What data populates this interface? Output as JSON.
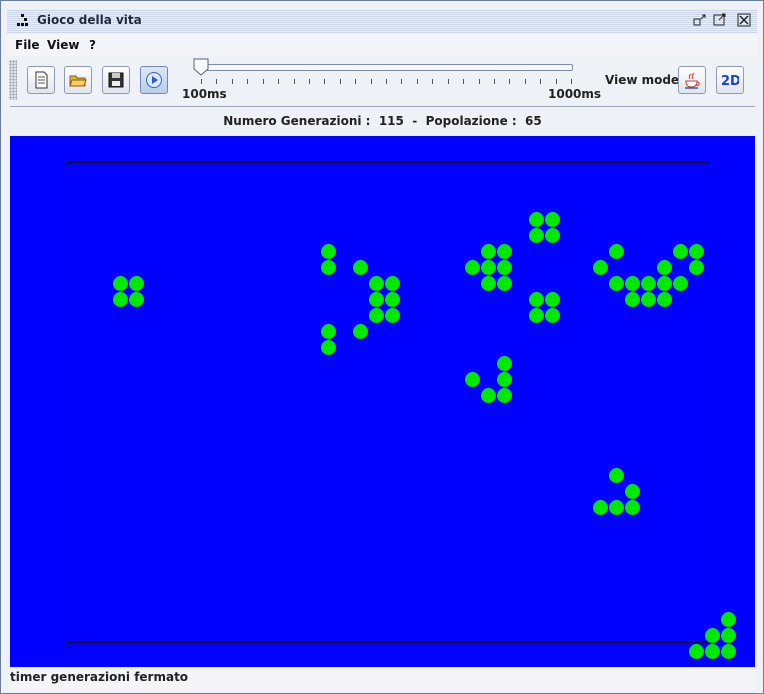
{
  "window": {
    "title": "Gioco della vita",
    "controls": [
      "restore-icon",
      "maximize-icon",
      "close-icon"
    ]
  },
  "menu": {
    "items": [
      "File",
      "View",
      "?"
    ]
  },
  "toolbar": {
    "buttons": [
      "new-file-icon",
      "open-folder-icon",
      "save-icon",
      "play-icon"
    ],
    "slider": {
      "min_label": "100ms",
      "max_label": "1000ms",
      "value_ms": 100
    },
    "view_mode_label": "View mode",
    "view_mode_buttons": [
      "java-3d-icon",
      "2d-icon"
    ]
  },
  "stats": {
    "generations_label": "Numero Generazioni :",
    "generations_value": "115",
    "separator": "-",
    "population_label": "Popolazione :",
    "population_value": "65"
  },
  "board": {
    "background": "#0000ff",
    "cell_color": "#00e800",
    "live_cells": [
      [
        1,
        6
      ],
      [
        2,
        6
      ],
      [
        1,
        7
      ],
      [
        2,
        7
      ],
      [
        14,
        4
      ],
      [
        14,
        5
      ],
      [
        16,
        5
      ],
      [
        17,
        6
      ],
      [
        18,
        6
      ],
      [
        17,
        7
      ],
      [
        18,
        7
      ],
      [
        17,
        8
      ],
      [
        18,
        8
      ],
      [
        14,
        9
      ],
      [
        16,
        9
      ],
      [
        14,
        10
      ],
      [
        27,
        2
      ],
      [
        28,
        2
      ],
      [
        27,
        3
      ],
      [
        28,
        3
      ],
      [
        24,
        4
      ],
      [
        25,
        4
      ],
      [
        23,
        5
      ],
      [
        24,
        5
      ],
      [
        25,
        5
      ],
      [
        24,
        6
      ],
      [
        25,
        6
      ],
      [
        27,
        7
      ],
      [
        28,
        7
      ],
      [
        27,
        8
      ],
      [
        28,
        8
      ],
      [
        25,
        11
      ],
      [
        23,
        12
      ],
      [
        25,
        12
      ],
      [
        24,
        13
      ],
      [
        25,
        13
      ],
      [
        32,
        4
      ],
      [
        36,
        4
      ],
      [
        37,
        4
      ],
      [
        31,
        5
      ],
      [
        35,
        5
      ],
      [
        37,
        5
      ],
      [
        32,
        6
      ],
      [
        33,
        6
      ],
      [
        34,
        6
      ],
      [
        35,
        6
      ],
      [
        36,
        6
      ],
      [
        33,
        7
      ],
      [
        34,
        7
      ],
      [
        35,
        7
      ],
      [
        32,
        18
      ],
      [
        33,
        19
      ],
      [
        31,
        20
      ],
      [
        32,
        20
      ],
      [
        33,
        20
      ],
      [
        39,
        27
      ],
      [
        38,
        28
      ],
      [
        39,
        28
      ],
      [
        37,
        29
      ],
      [
        38,
        29
      ],
      [
        39,
        29
      ]
    ]
  },
  "status": {
    "text": "timer generazioni fermato"
  }
}
